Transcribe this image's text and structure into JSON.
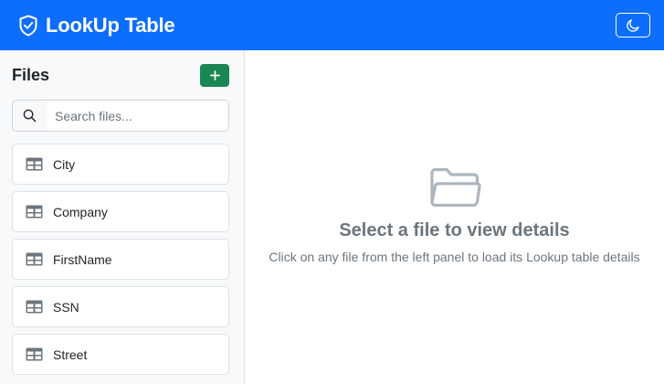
{
  "header": {
    "title": "LookUp Table",
    "logo_icon": "shield-check-icon",
    "theme_icon": "moon-icon",
    "background": "#0d6efd"
  },
  "sidebar": {
    "title": "Files",
    "add_icon": "plus-icon",
    "add_color": "#198754",
    "search": {
      "placeholder": "Search files...",
      "value": "",
      "icon": "search-icon"
    },
    "files": [
      {
        "label": "City",
        "icon": "table-icon"
      },
      {
        "label": "Company",
        "icon": "table-icon"
      },
      {
        "label": "FirstName",
        "icon": "table-icon"
      },
      {
        "label": "SSN",
        "icon": "table-icon"
      },
      {
        "label": "Street",
        "icon": "table-icon"
      }
    ]
  },
  "main": {
    "empty_icon": "folder-open-icon",
    "empty_title": "Select a file to view details",
    "empty_subtitle": "Click on any file from the left panel to load its Lookup table details"
  }
}
